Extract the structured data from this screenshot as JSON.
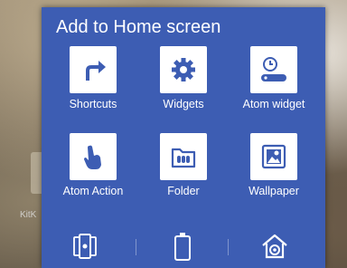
{
  "background": {
    "partial_label": "KitK"
  },
  "dialog": {
    "title": "Add to Home screen",
    "color": "#3d5db3",
    "items": [
      {
        "label": "Shortcuts",
        "icon": "share-arrow-icon"
      },
      {
        "label": "Widgets",
        "icon": "gear-icon"
      },
      {
        "label": "Atom widget",
        "icon": "clock-widget-icon"
      },
      {
        "label": "Atom Action",
        "icon": "touch-hand-icon"
      },
      {
        "label": "Folder",
        "icon": "folder-icon"
      },
      {
        "label": "Wallpaper",
        "icon": "wallpaper-icon"
      }
    ],
    "bottom_actions": [
      {
        "icon": "phone-cards-icon"
      },
      {
        "icon": "battery-icon"
      },
      {
        "icon": "home-settings-icon"
      }
    ]
  }
}
